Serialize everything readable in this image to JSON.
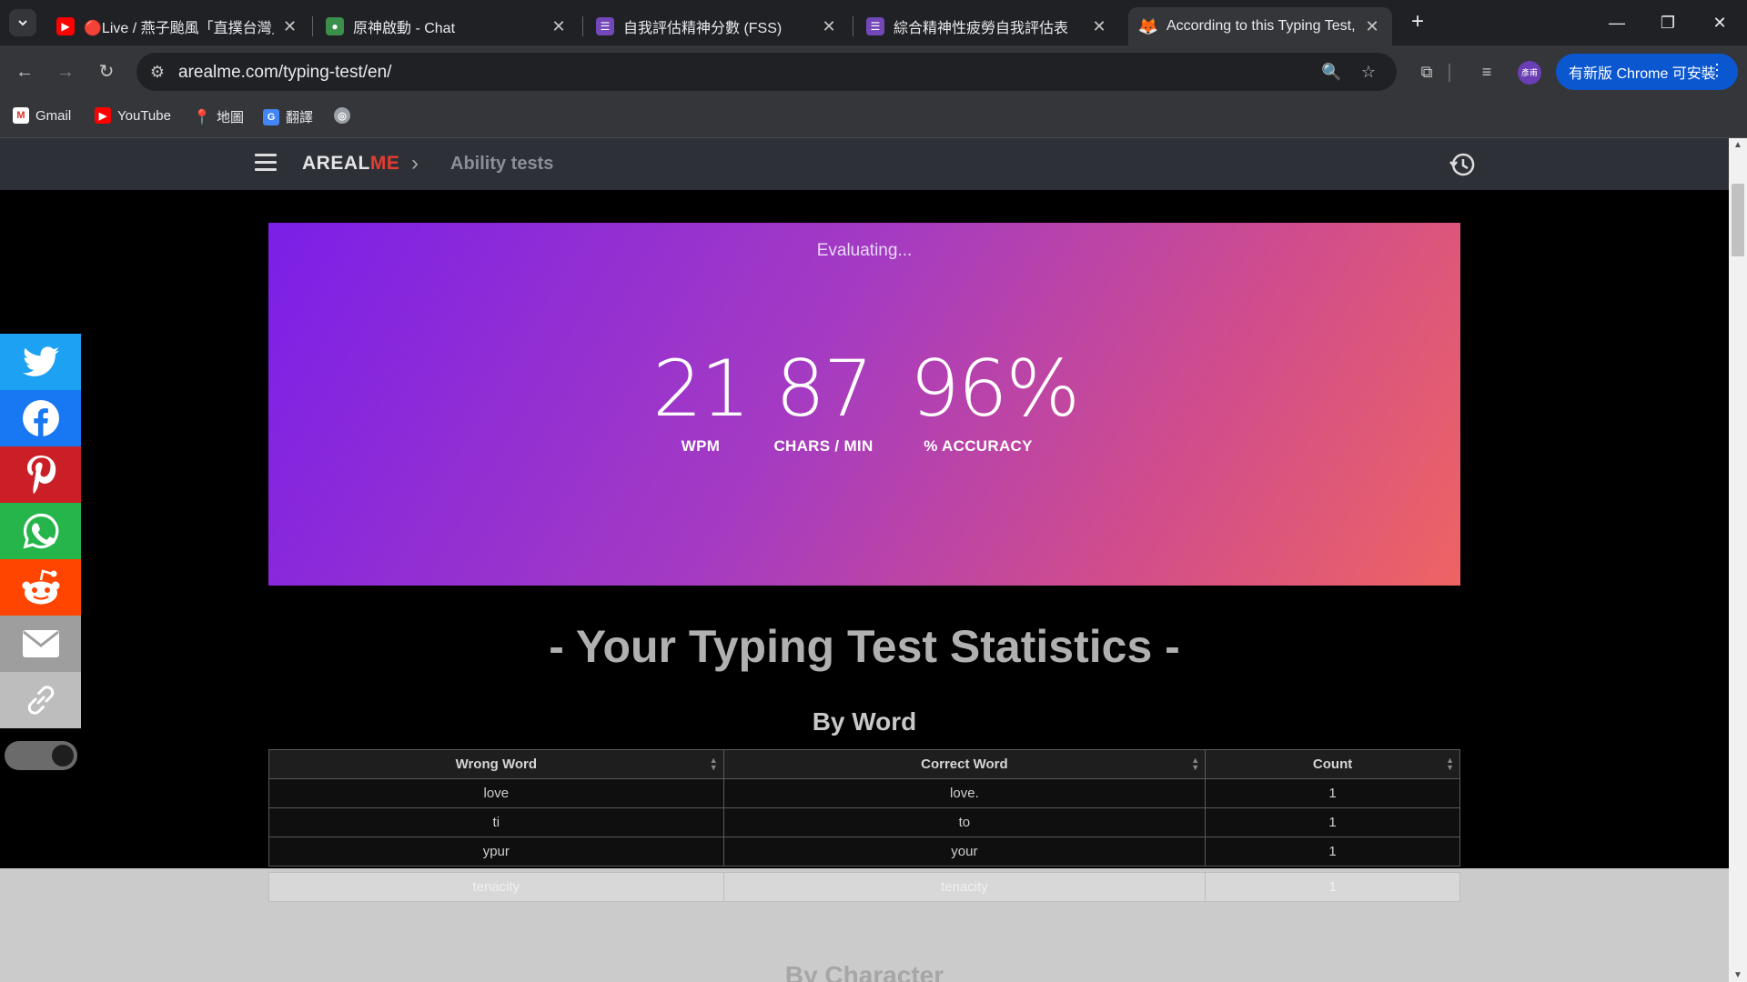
{
  "browser": {
    "tabs": [
      {
        "title": "🔴Live / 燕子颱風「直撲台灣」",
        "active": false
      },
      {
        "title": "原神啟動 - Chat",
        "active": false
      },
      {
        "title": "自我評估精神分數 (FSS)",
        "active": false
      },
      {
        "title": "綜合精神性疲勞自我評估表",
        "active": false
      },
      {
        "title": "According to this Typing Test,",
        "active": true
      }
    ],
    "url": "arealme.com/typing-test/en/",
    "update_label": "有新版 Chrome 可安裝",
    "profile_label": "彥甫",
    "bookmarks": [
      {
        "label": "Gmail",
        "icon": "gmail-icon"
      },
      {
        "label": "YouTube",
        "icon": "youtube-icon"
      },
      {
        "label": "地圖",
        "icon": "maps-icon"
      },
      {
        "label": "翻譯",
        "icon": "translate-icon"
      },
      {
        "label": "",
        "icon": "globe-icon"
      }
    ]
  },
  "site": {
    "logo_a": "AREAL",
    "logo_b": "ME",
    "breadcrumb": "Ability tests"
  },
  "result": {
    "status": "Evaluating...",
    "stats": [
      {
        "value": "21",
        "label": "WPM"
      },
      {
        "value": "87",
        "label": "CHARS / MIN"
      },
      {
        "value": "96%",
        "label": "% ACCURACY"
      }
    ]
  },
  "statistics": {
    "title": "- Your Typing Test Statistics -",
    "by_word_heading": "By Word",
    "columns": [
      "Wrong Word",
      "Correct Word",
      "Count"
    ],
    "rows": [
      {
        "wrong": "love",
        "correct": "love.",
        "count": "1"
      },
      {
        "wrong": "ti",
        "correct": "to",
        "count": "1"
      },
      {
        "wrong": "ypur",
        "correct": "your",
        "count": "1"
      },
      {
        "wrong": "tenacity",
        "correct": "tenacity",
        "count": "1"
      }
    ],
    "by_char_heading": "By Character"
  },
  "share": [
    "twitter",
    "facebook",
    "pinterest",
    "whatsapp",
    "reddit",
    "email",
    "link"
  ],
  "colors": {
    "twitter": "#1da1f2",
    "facebook": "#1877f2",
    "pinterest": "#cb1f27",
    "whatsapp": "#25b54a",
    "reddit": "#ff4500",
    "email": "#9e9e9e",
    "link": "#bdbdbd"
  }
}
